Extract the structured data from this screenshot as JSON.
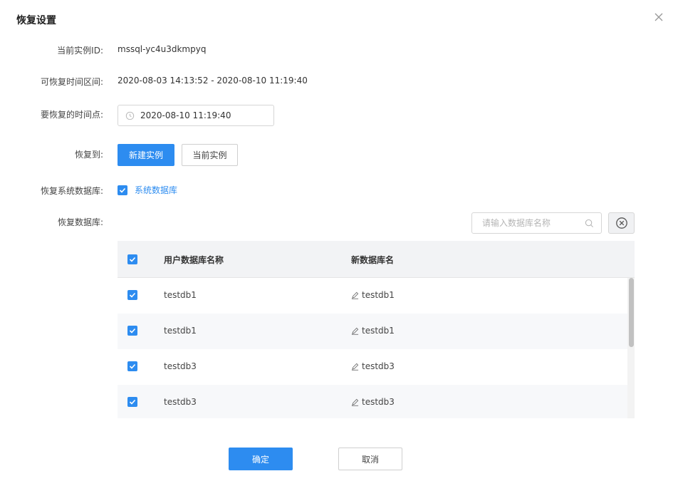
{
  "dialog": {
    "title": "恢复设置",
    "close_icon": "close-icon"
  },
  "form": {
    "instance_label": "当前实例ID:",
    "instance_value": "mssql-yc4u3dkmpyq",
    "range_label": "可恢复时间区间:",
    "range_value": "2020-08-03 14:13:52 - 2020-08-10 11:19:40",
    "time_label": "要恢复的时间点:",
    "time_value": "2020-08-10 11:19:40",
    "restore_to_label": "恢复到:",
    "restore_to_new": "新建实例",
    "restore_to_current": "当前实例",
    "system_db_label": "恢复系统数据库:",
    "system_db_option": "系统数据库",
    "db_label": "恢复数据库:",
    "search_placeholder": "请输入数据库名称"
  },
  "table": {
    "columns": [
      "用户数据库名称",
      "新数据库名"
    ],
    "rows": [
      {
        "user_db": "testdb1",
        "new_db": "testdb1"
      },
      {
        "user_db": "testdb1",
        "new_db": "testdb1"
      },
      {
        "user_db": "testdb3",
        "new_db": "testdb3"
      },
      {
        "user_db": "testdb3",
        "new_db": "testdb3"
      }
    ]
  },
  "footer": {
    "confirm": "确定",
    "cancel": "取消"
  },
  "colors": {
    "primary": "#2d8cf0",
    "header_bg": "#f2f3f5"
  }
}
